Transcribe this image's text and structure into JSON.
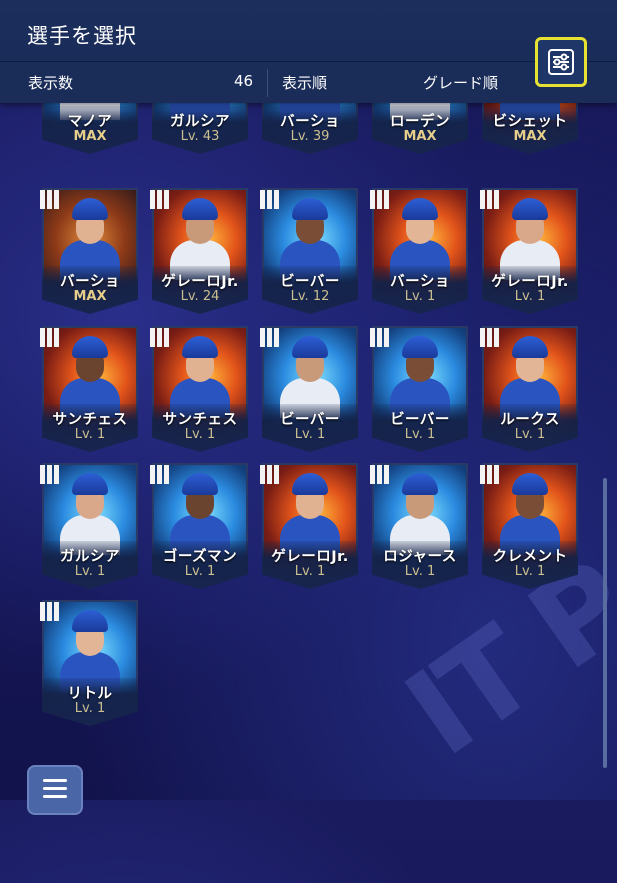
{
  "header": {
    "title": "選手を選択",
    "count_label": "表示数",
    "count_value": "46",
    "sort_label": "表示順",
    "sort_value": "グレード順",
    "filter_icon": "filter-settings-icon"
  },
  "colors": {
    "header_bg": "#1b2e5c",
    "highlight": "#e7e232",
    "level_text": "#cbbf8f",
    "max_text": "#e6cf8a"
  },
  "players": [
    {
      "name": "マノア",
      "level": "MAX",
      "grade": "III",
      "bg": "ice",
      "partial": true
    },
    {
      "name": "ガルシア",
      "level": "Lv. 43",
      "grade": "III",
      "bg": "ice",
      "partial": true
    },
    {
      "name": "バーショ",
      "level": "Lv. 39",
      "grade": "III",
      "bg": "ice",
      "partial": true
    },
    {
      "name": "ローデン",
      "level": "MAX",
      "grade": "III",
      "bg": "ice",
      "partial": true
    },
    {
      "name": "ビシェット",
      "level": "MAX",
      "grade": "III",
      "bg": "fire",
      "partial": true
    },
    {
      "name": "バーショ",
      "level": "MAX",
      "grade": "III",
      "bg": "bat"
    },
    {
      "name": "ゲレーロJr.",
      "level": "Lv. 24",
      "grade": "III",
      "bg": "fire"
    },
    {
      "name": "ビーバー",
      "level": "Lv. 12",
      "grade": "III",
      "bg": "ice"
    },
    {
      "name": "バーショ",
      "level": "Lv. 1",
      "grade": "III",
      "bg": "fire"
    },
    {
      "name": "ゲレーロJr.",
      "level": "Lv. 1",
      "grade": "III",
      "bg": "fire"
    },
    {
      "name": "サンチェス",
      "level": "Lv. 1",
      "grade": "III",
      "bg": "fire"
    },
    {
      "name": "サンチェス",
      "level": "Lv. 1",
      "grade": "III",
      "bg": "fire"
    },
    {
      "name": "ビーバー",
      "level": "Lv. 1",
      "grade": "III",
      "bg": "ice"
    },
    {
      "name": "ビーバー",
      "level": "Lv. 1",
      "grade": "III",
      "bg": "ice"
    },
    {
      "name": "ルークス",
      "level": "Lv. 1",
      "grade": "III",
      "bg": "fire"
    },
    {
      "name": "ガルシア",
      "level": "Lv. 1",
      "grade": "III",
      "bg": "ice"
    },
    {
      "name": "ゴーズマン",
      "level": "Lv. 1",
      "grade": "III",
      "bg": "ice"
    },
    {
      "name": "ゲレーロJr.",
      "level": "Lv. 1",
      "grade": "III",
      "bg": "fire"
    },
    {
      "name": "ロジャース",
      "level": "Lv. 1",
      "grade": "III",
      "bg": "ice"
    },
    {
      "name": "クレメント",
      "level": "Lv. 1",
      "grade": "III",
      "bg": "fire"
    },
    {
      "name": "リトル",
      "level": "Lv. 1",
      "grade": "III",
      "bg": "ice"
    }
  ],
  "menu_icon": "hamburger-menu-icon"
}
